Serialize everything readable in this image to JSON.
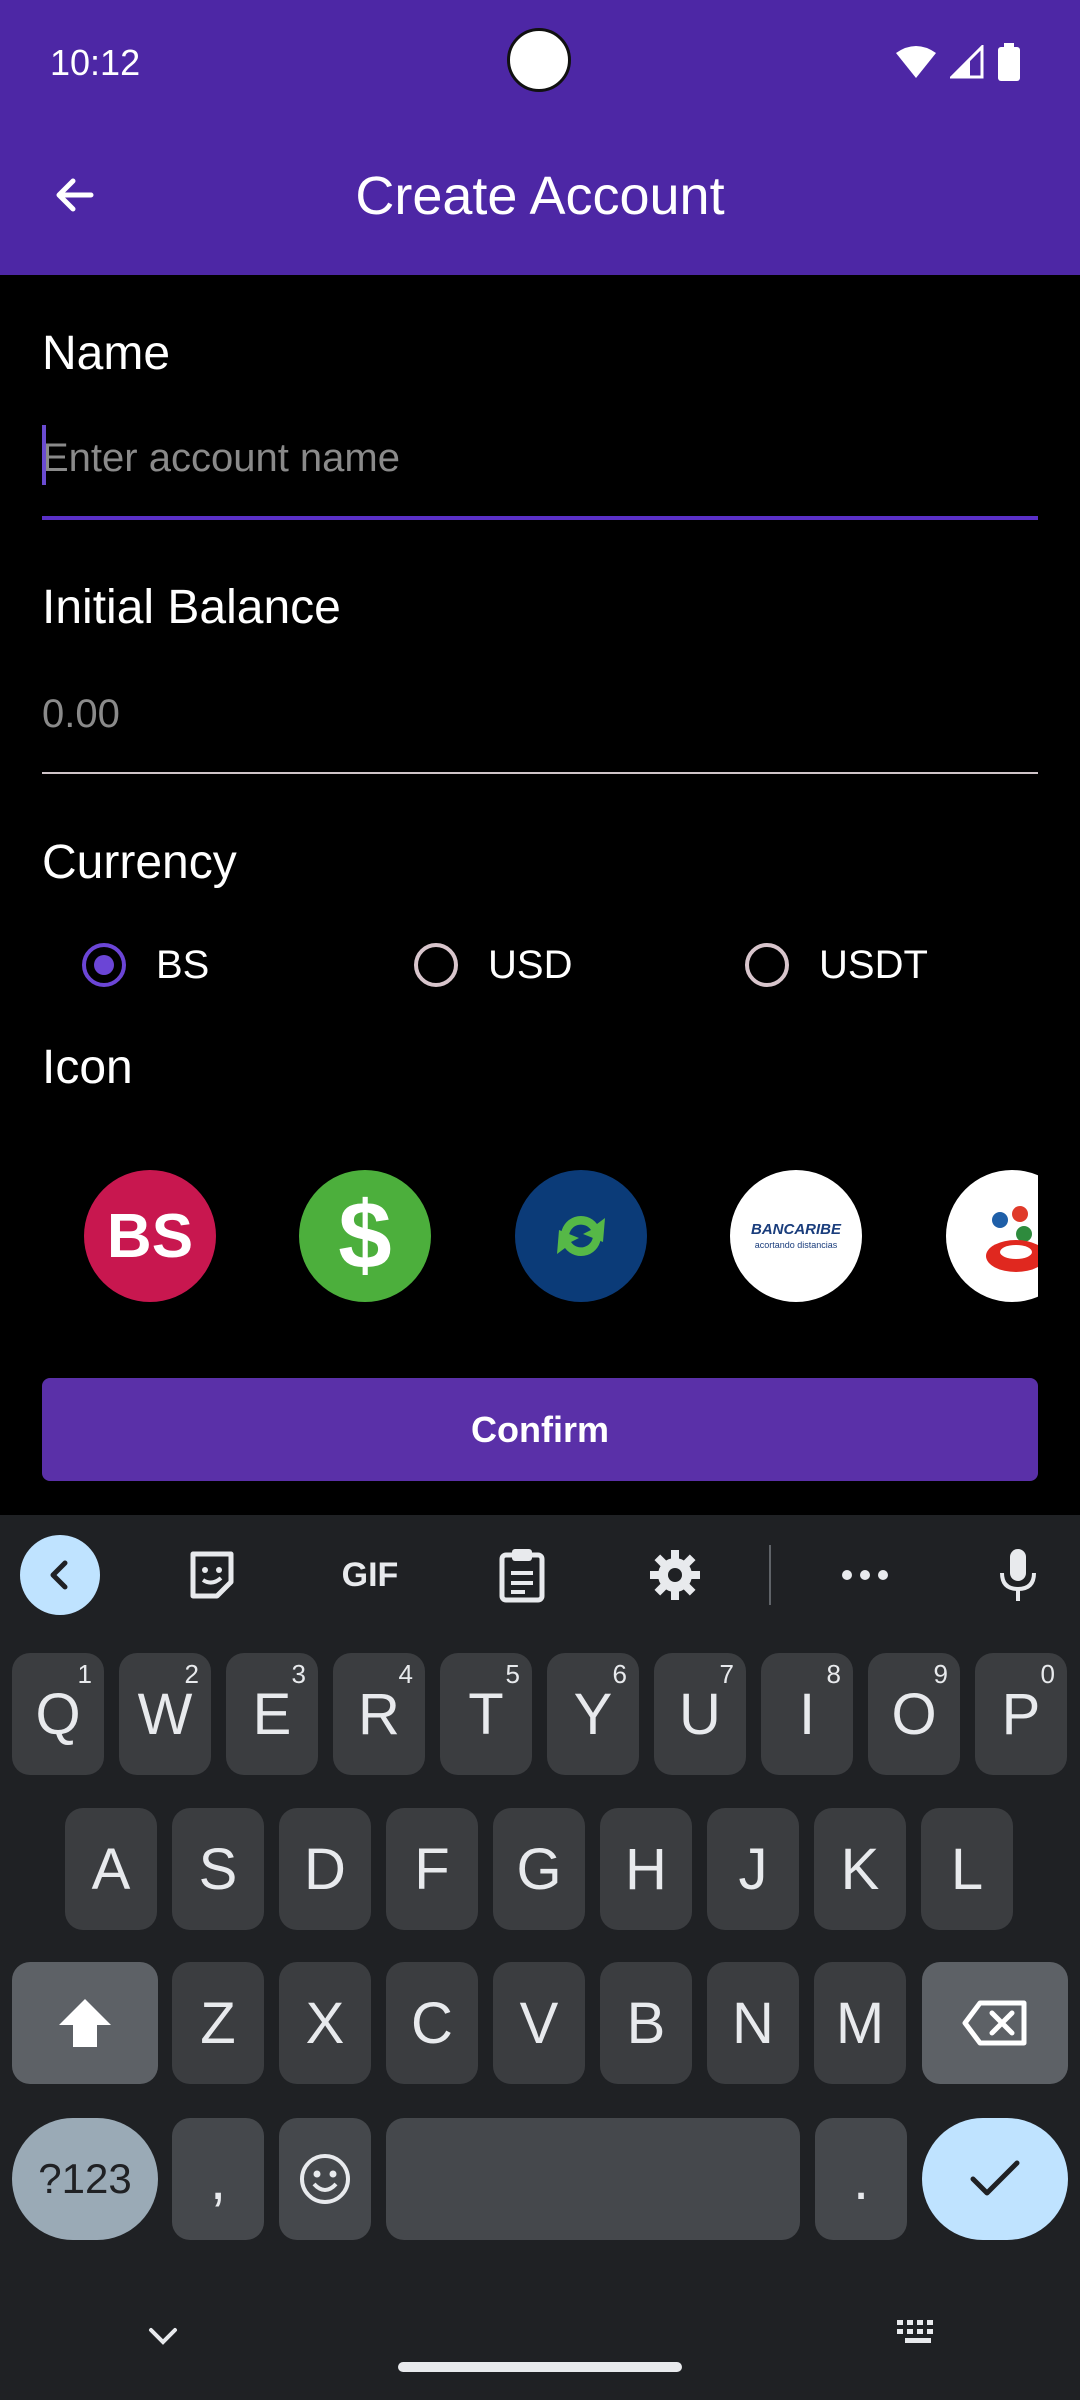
{
  "status_bar": {
    "time": "10:12"
  },
  "app_bar": {
    "title": "Create Account"
  },
  "form": {
    "name_label": "Name",
    "name_placeholder": "Enter account name",
    "balance_label": "Initial Balance",
    "balance_placeholder": "0.00",
    "currency_label": "Currency",
    "currency_options": [
      "BS",
      "USD",
      "USDT"
    ],
    "currency_selected": "BS",
    "icon_label": "Icon",
    "icons": [
      "bs-icon",
      "dollar-icon",
      "green-arrows-bank-icon",
      "bancaribe-icon",
      "red-circles-bank-icon"
    ],
    "bancaribe_text": "BANCARIBE",
    "bancaribe_sub": "acortando distancias",
    "bs_text": "BS",
    "confirm_label": "Confirm"
  },
  "keyboard": {
    "toolbar_gif": "GIF",
    "row1": [
      {
        "k": "Q",
        "n": "1"
      },
      {
        "k": "W",
        "n": "2"
      },
      {
        "k": "E",
        "n": "3"
      },
      {
        "k": "R",
        "n": "4"
      },
      {
        "k": "T",
        "n": "5"
      },
      {
        "k": "Y",
        "n": "6"
      },
      {
        "k": "U",
        "n": "7"
      },
      {
        "k": "I",
        "n": "8"
      },
      {
        "k": "O",
        "n": "9"
      },
      {
        "k": "P",
        "n": "0"
      }
    ],
    "row2": [
      "A",
      "S",
      "D",
      "F",
      "G",
      "H",
      "J",
      "K",
      "L"
    ],
    "row3": [
      "Z",
      "X",
      "C",
      "V",
      "B",
      "N",
      "M"
    ],
    "sym_label": "?123",
    "comma": ",",
    "period": "."
  },
  "colors": {
    "primary": "#4d27a5",
    "button": "#5a30a8",
    "accent": "#6b45d6"
  }
}
